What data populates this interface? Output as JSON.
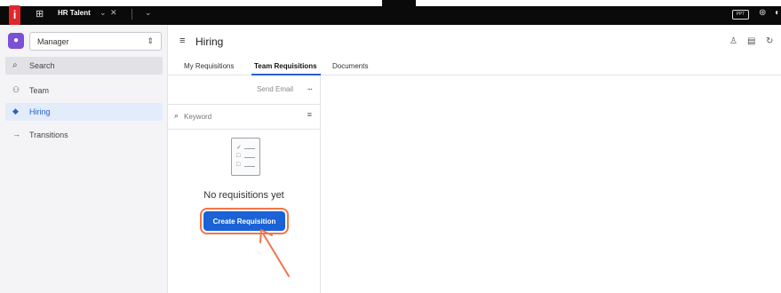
{
  "browser": {
    "app_label": "HR Talent",
    "badge_text": "PPT"
  },
  "sidebar": {
    "role_select": {
      "value": "Manager"
    },
    "search_label": "Search",
    "items": [
      {
        "label": "Team",
        "icon": "team-icon"
      },
      {
        "label": "Hiring",
        "icon": "hiring-icon",
        "active": true
      },
      {
        "label": "Transitions",
        "icon": "arrow-right-icon"
      }
    ]
  },
  "header": {
    "title": "Hiring"
  },
  "tabs": [
    {
      "label": "My Requisitions"
    },
    {
      "label": "Team Requisitions",
      "active": true
    },
    {
      "label": "Documents"
    }
  ],
  "panel": {
    "send_email_label": "Send Email",
    "more_label": "...",
    "search_placeholder": "Keyword",
    "empty_text": "No requisitions yet",
    "create_button_label": "Create Requisition"
  },
  "colors": {
    "accent": "#1a62d6",
    "highlight": "#f0764a",
    "brand": "#e0262b",
    "active_nav_bg": "#e3ecfb"
  }
}
